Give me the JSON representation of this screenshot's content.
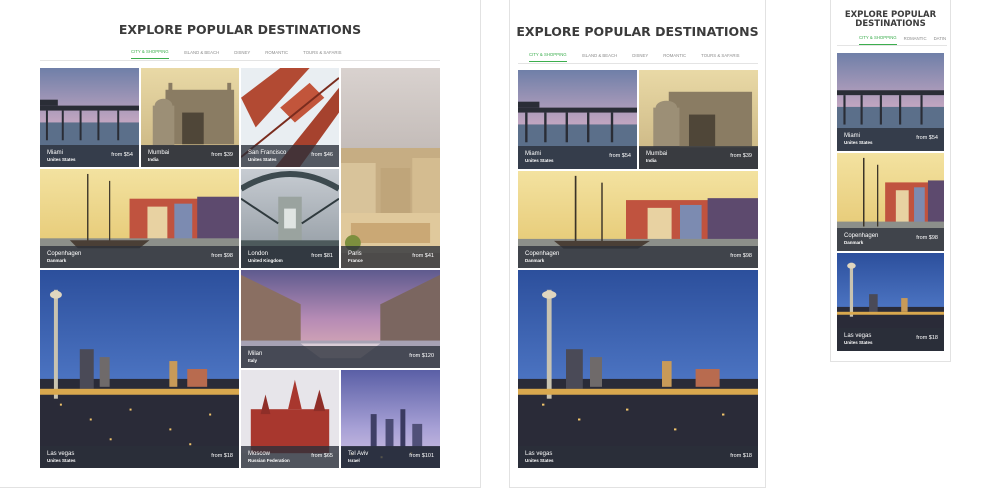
{
  "section": {
    "title": "EXPLORE POPULAR DESTINATIONS",
    "title_mobile_line1": "EXPLORE POPULAR",
    "title_mobile_line2": "DESTINATIONS"
  },
  "tabs": [
    {
      "label": "CITY & SHOPPING",
      "active": true
    },
    {
      "label": "ISLAND & BEACH",
      "active": false
    },
    {
      "label": "DISNEY",
      "active": false
    },
    {
      "label": "ROMANTIC",
      "active": false
    },
    {
      "label": "TOURS & SAFARIS",
      "active": false
    }
  ],
  "mobile_tabs": [
    "CITY & SHOPPING",
    "ROMANTIC",
    "DATIN"
  ],
  "destinations": {
    "miami": {
      "city": "Miami",
      "country": "Unites States",
      "price": "from $54"
    },
    "mumbai": {
      "city": "Mumbai",
      "country": "India",
      "price": "from $39"
    },
    "sanfrancisco": {
      "city": "San Francisco",
      "country": "Unites States",
      "price": "from $46"
    },
    "copenhagen": {
      "city": "Copenhagen",
      "country": "Danmark",
      "price": "from $98"
    },
    "london": {
      "city": "London",
      "country": "United Kingdom",
      "price": "from $81"
    },
    "paris": {
      "city": "Paris",
      "country": "France",
      "price": "from $41"
    },
    "milan": {
      "city": "Milan",
      "country": "Italy",
      "price": "from $120"
    },
    "lasvegas": {
      "city": "Las vegas",
      "country": "Unites States",
      "price": "from $18"
    },
    "moscow": {
      "city": "Moscow",
      "country": "Russian Federation",
      "price": "from $65"
    },
    "telaviv": {
      "city": "Tel Aviv",
      "country": "Israel",
      "price": "from $101"
    }
  },
  "colors": {
    "accent": "#3cae4e",
    "caption_bg": "#2a303a",
    "title": "#3b3b3b"
  }
}
